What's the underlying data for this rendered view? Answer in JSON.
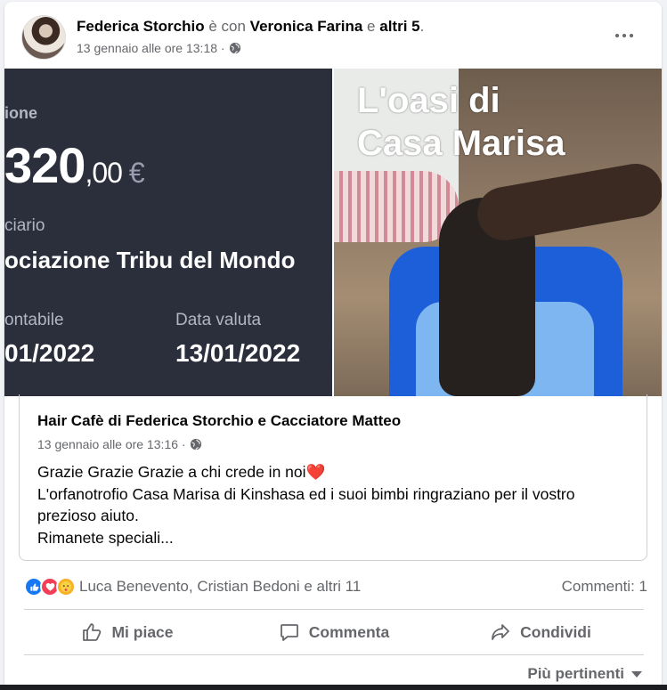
{
  "post": {
    "author": "Federica Storchio",
    "with_text": "è con",
    "tagged": "Veronica Farina",
    "and_text": "e",
    "others": "altri 5",
    "timestamp": "13 gennaio alle ore 13:18 ·",
    "audience_icon": "globe-icon"
  },
  "media": {
    "receipt": {
      "label_operation": "ione",
      "amount_int": "320",
      "amount_dec": ",00",
      "currency": "€",
      "label_beneficiary": "ciario",
      "beneficiary": "ociazione Tribu del Mondo",
      "label_accounting": "ontabile",
      "label_value_date": "Data valuta",
      "accounting_date": "01/2022",
      "value_date": "13/01/2022"
    },
    "photo": {
      "title_line1": "L'oasi di",
      "title_line2": "Casa Marisa"
    }
  },
  "shared_post": {
    "page_name": "Hair Cafè di Federica Storchio e Cacciatore Matteo",
    "timestamp": "13 gennaio alle ore 13:16 ·",
    "line1": "Grazie Grazie Grazie a chi crede in noi",
    "heart": "❤️",
    "line2": "L'orfanotrofio Casa Marisa di Kinshasa ed i suoi bimbi ringraziano per il vostro prezioso aiuto.",
    "line3": "Rimanete speciali..."
  },
  "reactions": {
    "names": "Luca Benevento, Cristian Bedoni e altri 11",
    "comments": "Commenti: 1"
  },
  "actions": {
    "like": "Mi piace",
    "comment": "Commenta",
    "share": "Condividi"
  },
  "sort": {
    "label": "Più pertinenti"
  },
  "colors": {
    "like_blue": "#1877f2",
    "love_red": "#f33e58",
    "care_yellow": "#f7b125",
    "muted_text": "#65676b",
    "receipt_bg": "#2b2e3b"
  }
}
